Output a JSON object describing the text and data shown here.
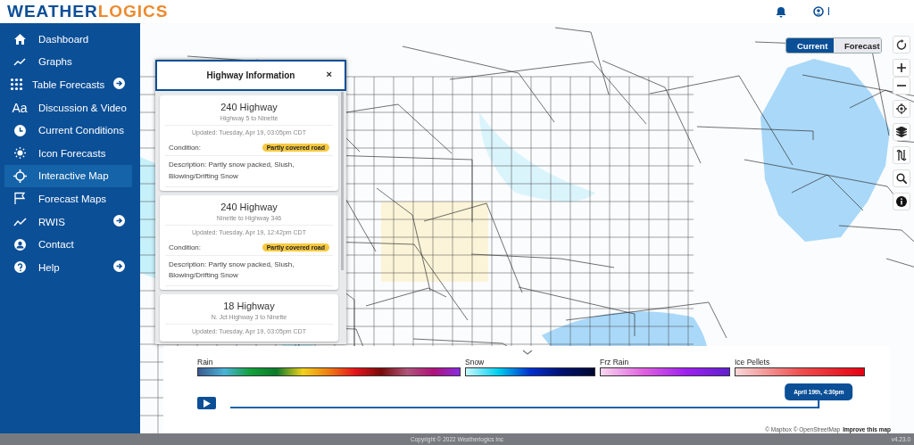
{
  "header": {
    "logo_part_1": "WEATHER",
    "logo_part_2": "LOGICS",
    "user_label": "I"
  },
  "sidebar": {
    "items": [
      {
        "label": "Dashboard",
        "selected": false,
        "has_submenu": false
      },
      {
        "label": "Graphs",
        "selected": false,
        "has_submenu": false
      },
      {
        "label": "Table Forecasts",
        "selected": false,
        "has_submenu": true
      },
      {
        "label": "Discussion & Video",
        "selected": false,
        "has_submenu": false,
        "icon_text": "Aa"
      },
      {
        "label": "Current Conditions",
        "selected": false,
        "has_submenu": false
      },
      {
        "label": "Icon Forecasts",
        "selected": false,
        "has_submenu": false
      },
      {
        "label": "Interactive Map",
        "selected": true,
        "has_submenu": false
      },
      {
        "label": "Forecast Maps",
        "selected": false,
        "has_submenu": false
      },
      {
        "label": "RWIS",
        "selected": false,
        "has_submenu": true
      },
      {
        "label": "Contact",
        "selected": false,
        "has_submenu": false
      },
      {
        "label": "Help",
        "selected": false,
        "has_submenu": true
      }
    ]
  },
  "map": {
    "mode_toggle": [
      {
        "label": "Current",
        "selected": true
      },
      {
        "label": "Forecast",
        "selected": false
      }
    ],
    "attribution": "© Mapbox © OpenStreetMap",
    "improve_link": "Improve this map"
  },
  "highway_popup": {
    "title": "Highway Information",
    "close": "×",
    "cards": [
      {
        "title": "240 Highway",
        "segment": "Highway 5 to Ninette",
        "updated": "Updated: Tuesday, Apr 19, 03:05pm CDT",
        "condition_label": "Condition:",
        "condition": "Partly covered road",
        "description": "Description: Partly snow packed, Slush, Blowing/Drifting Snow"
      },
      {
        "title": "240 Highway",
        "segment": "Ninette to Highway 346",
        "updated": "Updated: Tuesday, Apr 19, 12:42pm CDT",
        "condition_label": "Condition:",
        "condition": "Partly covered road",
        "description": "Description: Partly snow packed, Slush, Blowing/Drifting Snow"
      },
      {
        "title": "18 Highway",
        "segment": "N. Jct Highway 3 to Ninette",
        "updated": "Updated: Tuesday, Apr 19, 03:05pm CDT"
      }
    ]
  },
  "legend": {
    "scales": [
      {
        "label": "Rain"
      },
      {
        "label": "Snow"
      },
      {
        "label": "Frz Rain"
      },
      {
        "label": "Ice Pellets"
      }
    ],
    "timeline": {
      "time_label": "April 19th, 4:30pm",
      "level": 0.99
    }
  },
  "footer": {
    "copyright": "Copyright © 2022 Weatherlogics Inc",
    "version": "v4.23.0"
  }
}
